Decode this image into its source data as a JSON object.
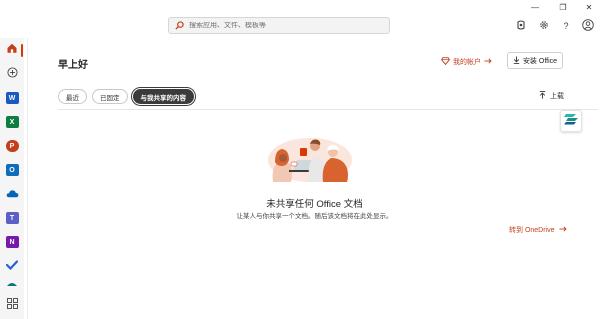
{
  "window": {
    "minimize_glyph": "—",
    "restore_glyph": "❐",
    "close_glyph": "✕"
  },
  "search": {
    "placeholder": "搜索应用、文件、模板等"
  },
  "header_icons": [
    "copilot-icon",
    "settings-icon",
    "help-icon",
    "account-icon"
  ],
  "header": {
    "help_glyph": "?"
  },
  "rail": {
    "items": [
      {
        "name": "home",
        "icon": "home-icon"
      },
      {
        "name": "create",
        "icon": "plus-icon"
      },
      {
        "name": "word",
        "letter": "W",
        "color": "#185abd"
      },
      {
        "name": "excel",
        "letter": "X",
        "color": "#107c41"
      },
      {
        "name": "powerpoint",
        "letter": "P",
        "color": "#c43e1c"
      },
      {
        "name": "outlook",
        "letter": "O",
        "color": "#0f6cbd"
      },
      {
        "name": "onedrive",
        "icon": "cloud-icon",
        "color": "#0364b8"
      },
      {
        "name": "teams",
        "letter": "T",
        "color": "#5b5fc7"
      },
      {
        "name": "onenote",
        "letter": "N",
        "color": "#7719aa"
      },
      {
        "name": "todo",
        "icon": "check-icon",
        "color": "#2564cf"
      },
      {
        "name": "more",
        "icon": "teal-app-icon",
        "color": "#03787c"
      },
      {
        "name": "all-apps",
        "icon": "apps-grid-icon"
      }
    ]
  },
  "main": {
    "greeting": "早上好",
    "account_link": "我的帐户",
    "install_label": "安装 Office",
    "tabs": [
      {
        "label": "最近",
        "active": false
      },
      {
        "label": "已固定",
        "active": false
      },
      {
        "label": "与我共享的内容",
        "active": true
      }
    ],
    "upload_label": "上载",
    "empty_title": "未共享任何 Office 文档",
    "empty_subtitle": "让某人与你共享一个文档。随后该文档将在此处显示。",
    "onedrive_link": "转到 OneDrive",
    "accent_color": "#c43e1c"
  }
}
